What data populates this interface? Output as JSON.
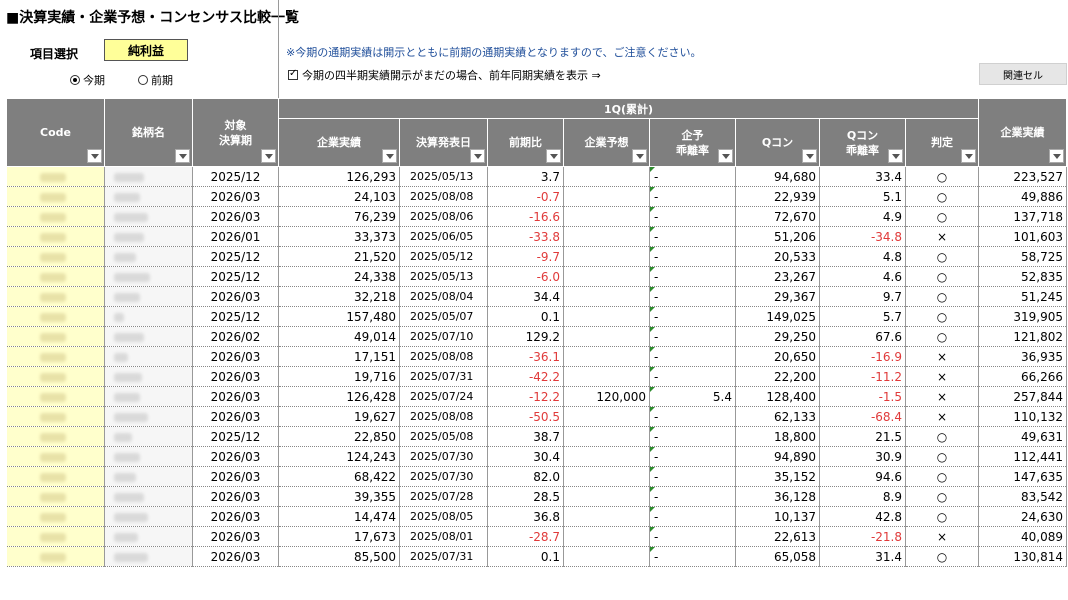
{
  "page_title": "■決算実績・企業予想・コンセンサス比較一覧",
  "selector": {
    "label": "項目選択",
    "value": "純利益"
  },
  "period_radio": {
    "current_label": "今期",
    "previous_label": "前期",
    "selected": "current"
  },
  "notice": "※今期の通期実績は開示とともに前期の通期実績となりますので、ご注意ください。",
  "checkbox": {
    "label": "今期の四半期実績開示がまだの場合、前年同期実績を表示 ⇒",
    "checked": true
  },
  "related_button": "関連セル",
  "table": {
    "group_header": "1Q(累計)",
    "headers": {
      "code": "Code",
      "name": "銘柄名",
      "period_1": "対象",
      "period_2": "決算期",
      "actual": "企業実績",
      "date": "決算発表日",
      "yoy": "前期比",
      "forecast": "企業予想",
      "fdev_1": "企予",
      "fdev_2": "乖離率",
      "qcon": "Qコン",
      "qdev_1": "Qコン",
      "qdev_2": "乖離率",
      "judge": "判定",
      "actual2": "企業実績"
    },
    "rows": [
      {
        "period": "2025/12",
        "actual": "126,293",
        "date": "2025/05/13",
        "yoy": "3.7",
        "forecast": "",
        "fdev": "-",
        "qcon": "94,680",
        "qdev": "33.4",
        "judge": "○",
        "actual2": "223,527"
      },
      {
        "period": "2026/03",
        "actual": "24,103",
        "date": "2025/08/08",
        "yoy": "-0.7",
        "forecast": "",
        "fdev": "-",
        "qcon": "22,939",
        "qdev": "5.1",
        "judge": "○",
        "actual2": "49,886"
      },
      {
        "period": "2026/03",
        "actual": "76,239",
        "date": "2025/08/06",
        "yoy": "-16.6",
        "forecast": "",
        "fdev": "-",
        "qcon": "72,670",
        "qdev": "4.9",
        "judge": "○",
        "actual2": "137,718"
      },
      {
        "period": "2026/01",
        "actual": "33,373",
        "date": "2025/06/05",
        "yoy": "-33.8",
        "forecast": "",
        "fdev": "-",
        "qcon": "51,206",
        "qdev": "-34.8",
        "judge": "×",
        "actual2": "101,603"
      },
      {
        "period": "2025/12",
        "actual": "21,520",
        "date": "2025/05/12",
        "yoy": "-9.7",
        "forecast": "",
        "fdev": "-",
        "qcon": "20,533",
        "qdev": "4.8",
        "judge": "○",
        "actual2": "58,725"
      },
      {
        "period": "2025/12",
        "actual": "24,338",
        "date": "2025/05/13",
        "yoy": "-6.0",
        "forecast": "",
        "fdev": "-",
        "qcon": "23,267",
        "qdev": "4.6",
        "judge": "○",
        "actual2": "52,835"
      },
      {
        "period": "2026/03",
        "actual": "32,218",
        "date": "2025/08/04",
        "yoy": "34.4",
        "forecast": "",
        "fdev": "-",
        "qcon": "29,367",
        "qdev": "9.7",
        "judge": "○",
        "actual2": "51,245"
      },
      {
        "period": "2025/12",
        "actual": "157,480",
        "date": "2025/05/07",
        "yoy": "0.1",
        "forecast": "",
        "fdev": "-",
        "qcon": "149,025",
        "qdev": "5.7",
        "judge": "○",
        "actual2": "319,905"
      },
      {
        "period": "2026/02",
        "actual": "49,014",
        "date": "2025/07/10",
        "yoy": "129.2",
        "forecast": "",
        "fdev": "-",
        "qcon": "29,250",
        "qdev": "67.6",
        "judge": "○",
        "actual2": "121,802"
      },
      {
        "period": "2026/03",
        "actual": "17,151",
        "date": "2025/08/08",
        "yoy": "-36.1",
        "forecast": "",
        "fdev": "-",
        "qcon": "20,650",
        "qdev": "-16.9",
        "judge": "×",
        "actual2": "36,935"
      },
      {
        "period": "2026/03",
        "actual": "19,716",
        "date": "2025/07/31",
        "yoy": "-42.2",
        "forecast": "",
        "fdev": "-",
        "qcon": "22,200",
        "qdev": "-11.2",
        "judge": "×",
        "actual2": "66,266"
      },
      {
        "period": "2026/03",
        "actual": "126,428",
        "date": "2025/07/24",
        "yoy": "-12.2",
        "forecast": "120,000",
        "fdev": "5.4",
        "qcon": "128,400",
        "qdev": "-1.5",
        "judge": "×",
        "actual2": "257,844"
      },
      {
        "period": "2026/03",
        "actual": "19,627",
        "date": "2025/08/08",
        "yoy": "-50.5",
        "forecast": "",
        "fdev": "-",
        "qcon": "62,133",
        "qdev": "-68.4",
        "judge": "×",
        "actual2": "110,132"
      },
      {
        "period": "2025/12",
        "actual": "22,850",
        "date": "2025/05/08",
        "yoy": "38.7",
        "forecast": "",
        "fdev": "-",
        "qcon": "18,800",
        "qdev": "21.5",
        "judge": "○",
        "actual2": "49,631"
      },
      {
        "period": "2026/03",
        "actual": "124,243",
        "date": "2025/07/30",
        "yoy": "30.4",
        "forecast": "",
        "fdev": "-",
        "qcon": "94,890",
        "qdev": "30.9",
        "judge": "○",
        "actual2": "112,441"
      },
      {
        "period": "2026/03",
        "actual": "68,422",
        "date": "2025/07/30",
        "yoy": "82.0",
        "forecast": "",
        "fdev": "-",
        "qcon": "35,152",
        "qdev": "94.6",
        "judge": "○",
        "actual2": "147,635"
      },
      {
        "period": "2026/03",
        "actual": "39,355",
        "date": "2025/07/28",
        "yoy": "28.5",
        "forecast": "",
        "fdev": "-",
        "qcon": "36,128",
        "qdev": "8.9",
        "judge": "○",
        "actual2": "83,542"
      },
      {
        "period": "2026/03",
        "actual": "14,474",
        "date": "2025/08/05",
        "yoy": "36.8",
        "forecast": "",
        "fdev": "-",
        "qcon": "10,137",
        "qdev": "42.8",
        "judge": "○",
        "actual2": "24,630"
      },
      {
        "period": "2026/03",
        "actual": "17,673",
        "date": "2025/08/01",
        "yoy": "-28.7",
        "forecast": "",
        "fdev": "-",
        "qcon": "22,613",
        "qdev": "-21.8",
        "judge": "×",
        "actual2": "40,089"
      },
      {
        "period": "2026/03",
        "actual": "85,500",
        "date": "2025/07/31",
        "yoy": "0.1",
        "forecast": "",
        "fdev": "-",
        "qcon": "65,058",
        "qdev": "31.4",
        "judge": "○",
        "actual2": "130,814"
      }
    ]
  }
}
